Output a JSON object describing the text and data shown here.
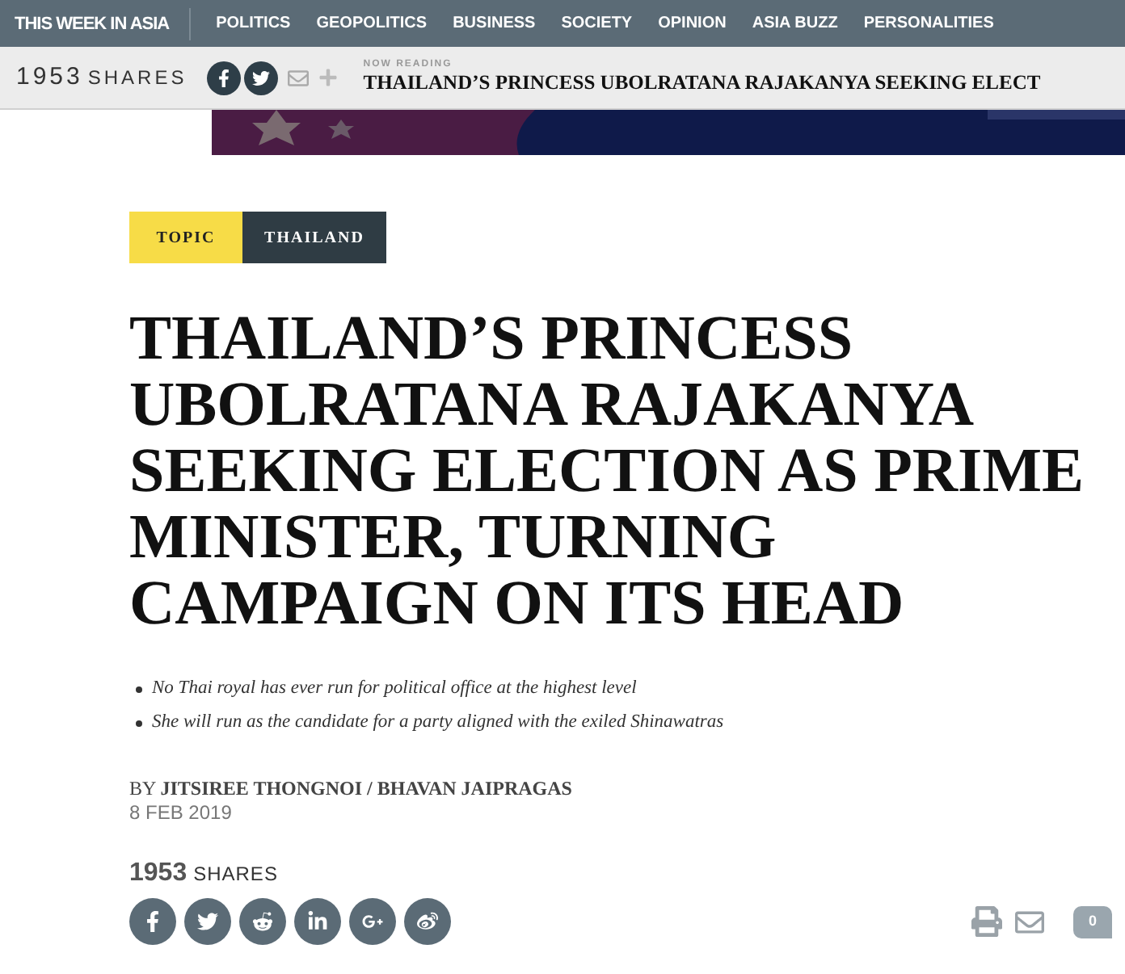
{
  "nav": {
    "brand": "THIS WEEK IN ASIA",
    "items": [
      "POLITICS",
      "GEOPOLITICS",
      "BUSINESS",
      "SOCIETY",
      "OPINION",
      "ASIA BUZZ",
      "PERSONALITIES"
    ]
  },
  "share_bar": {
    "count": "1953",
    "label": "SHARES",
    "now_reading_label": "NOW READING",
    "now_reading_title": "THAILAND’S PRINCESS UBOLRATANA RAJAKANYA SEEKING ELECT"
  },
  "tags": [
    {
      "label": "TOPIC",
      "kind": "label"
    },
    {
      "label": "THAILAND",
      "kind": "topic"
    }
  ],
  "headline": "THAILAND’S PRINCESS UBOLRATANA RAJAKANYA SEEKING ELECTION AS PRIME MINISTER, TURNING CAMPAIGN ON ITS HEAD",
  "bullets": [
    "No Thai royal has ever run for political office at the highest level",
    "She will run as the candidate for a party aligned with the exiled Shinawatras"
  ],
  "byline": "BY **JITSIREE THONGNOI / BHAVAN JAIPRAGAS**",
  "date": "8 FEB 2019",
  "shares": {
    "count": "1953",
    "label": "SHARES"
  },
  "comments": {
    "count": "0"
  }
}
